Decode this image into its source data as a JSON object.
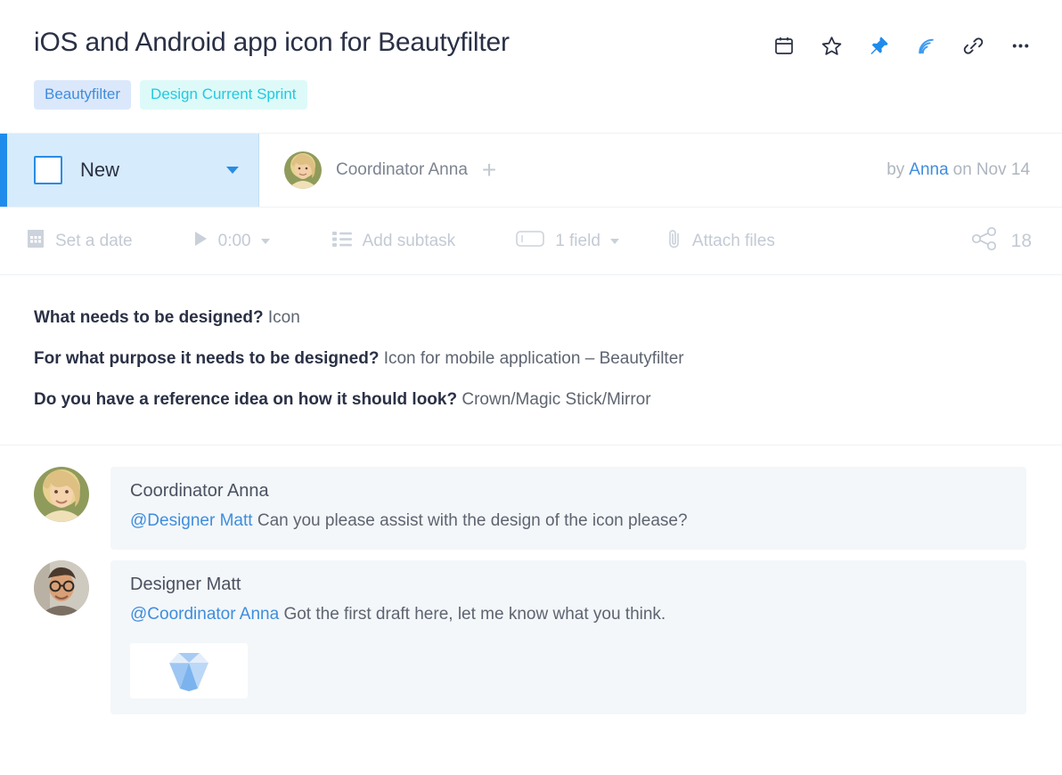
{
  "header": {
    "title": "iOS and Android app icon for Beautyfilter",
    "actions": [
      {
        "name": "calendar-icon",
        "label": "Set deadline"
      },
      {
        "name": "star-icon",
        "label": "Add to favorites"
      },
      {
        "name": "pin-icon",
        "label": "Pin"
      },
      {
        "name": "subscribe-icon",
        "label": "Subscribe"
      },
      {
        "name": "link-icon",
        "label": "Copy link"
      },
      {
        "name": "more-icon",
        "label": "More"
      }
    ]
  },
  "tags": [
    {
      "label": "Beautyfilter",
      "bg": "#dbe8fb",
      "color": "#3f8ddd"
    },
    {
      "label": "Design Current Sprint",
      "bg": "#ddfaf9",
      "color": "#24c8e0"
    }
  ],
  "status": {
    "label": "New",
    "accent_color": "#1f8cec",
    "chip_bg": "#d6ebfb"
  },
  "assignee": {
    "name": "Coordinator Anna",
    "add_label": "+"
  },
  "byline": {
    "by": "by",
    "author": "Anna",
    "on": "on",
    "date": "Nov 14"
  },
  "toolbar": {
    "set_date": "Set a date",
    "timer": "0:00",
    "add_subtask": "Add subtask",
    "fields": "1 field",
    "attach_files": "Attach files",
    "share_count": "18"
  },
  "description": [
    {
      "question": "What needs to be designed?",
      "answer": "Icon"
    },
    {
      "question": "For what purpose it needs to be designed?",
      "answer": "Icon for mobile application – Beautyfilter"
    },
    {
      "question": "Do you have a reference idea on how it should look?",
      "answer": "Crown/Magic Stick/Mirror"
    }
  ],
  "comments": [
    {
      "author": "Coordinator Anna",
      "mention": "@Designer Matt",
      "text": "Can you please assist with the design of the icon please?",
      "has_attachment": false
    },
    {
      "author": "Designer Matt",
      "mention": "@Coordinator Anna",
      "text": "Got the first draft here, let me know what you think.",
      "has_attachment": true,
      "attachment_name": "diamond-thumbnail"
    }
  ]
}
